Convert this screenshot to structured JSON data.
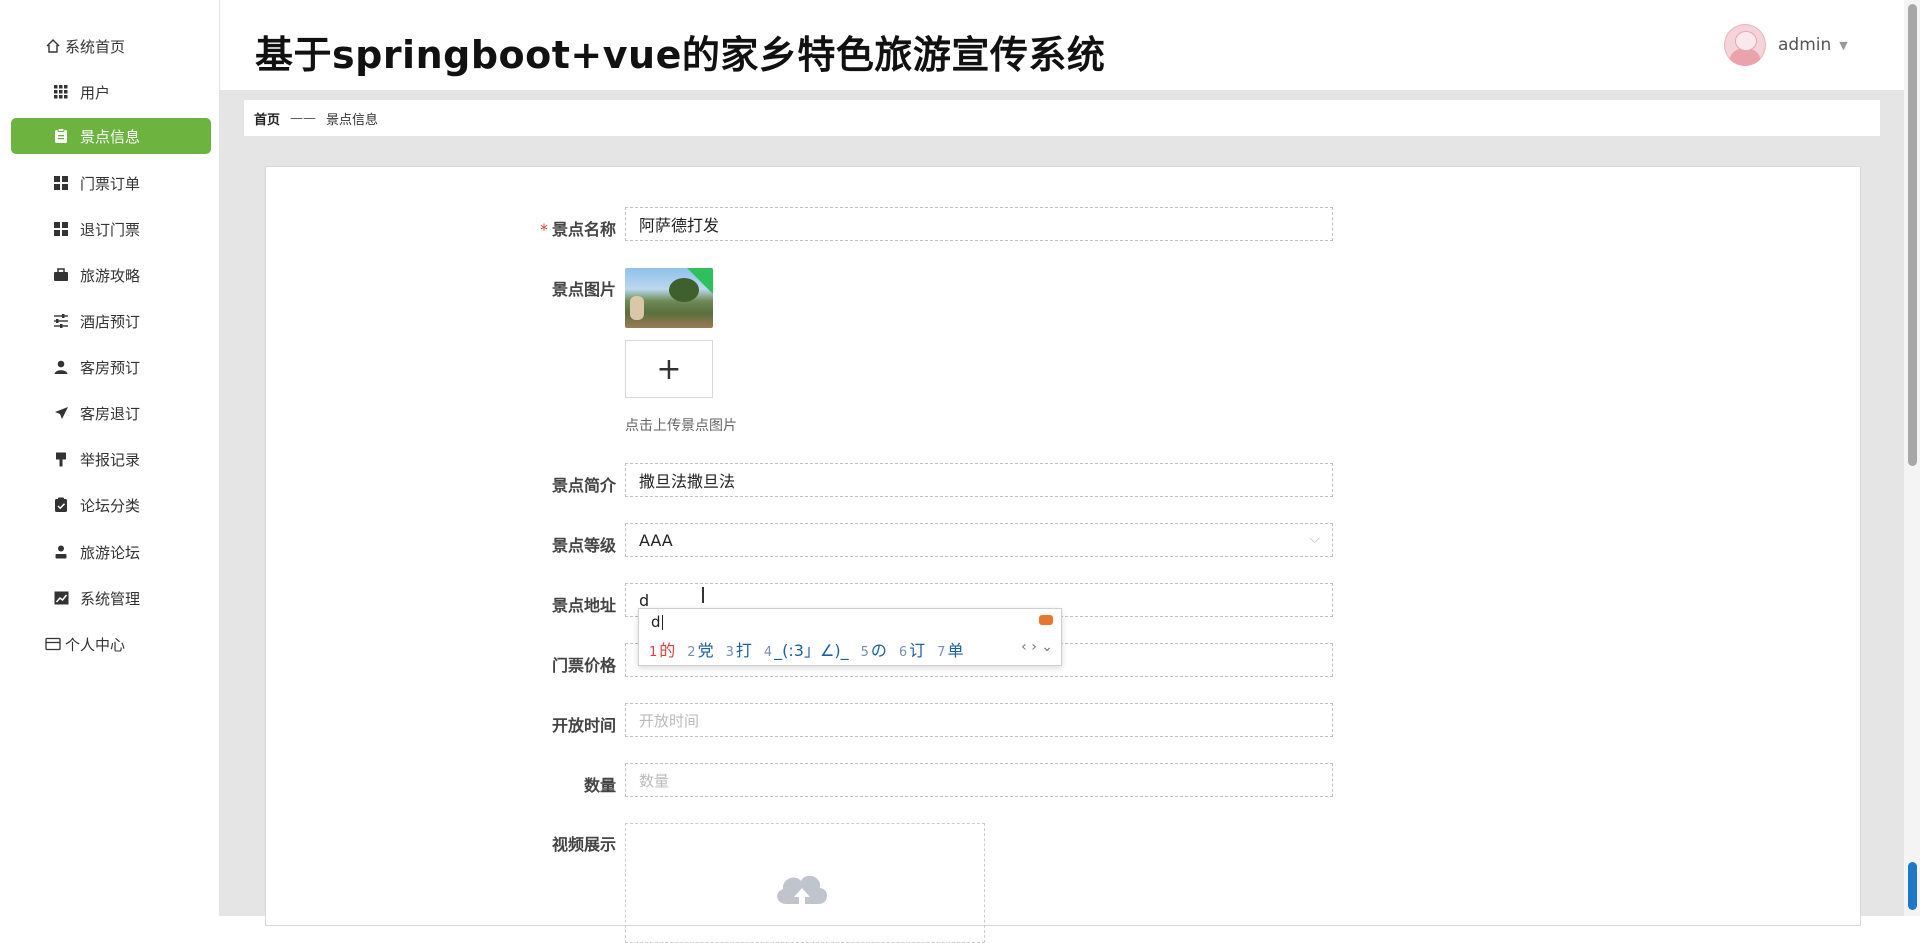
{
  "sidebar": {
    "items": [
      {
        "label": "系统首页",
        "icon": "home-icon",
        "active": false
      },
      {
        "label": "用户",
        "icon": "grid-icon",
        "active": false
      },
      {
        "label": "景点信息",
        "icon": "clipboard-icon",
        "active": true
      },
      {
        "label": "门票订单",
        "icon": "dashboard-icon",
        "active": false
      },
      {
        "label": "退订门票",
        "icon": "dashboard-icon",
        "active": false
      },
      {
        "label": "旅游攻略",
        "icon": "briefcase-icon",
        "active": false
      },
      {
        "label": "酒店预订",
        "icon": "sliders-icon",
        "active": false
      },
      {
        "label": "客房预订",
        "icon": "user-icon",
        "active": false
      },
      {
        "label": "客房退订",
        "icon": "send-icon",
        "active": false
      },
      {
        "label": "举报记录",
        "icon": "pin-icon",
        "active": false
      },
      {
        "label": "论坛分类",
        "icon": "clipboard-check-icon",
        "active": false
      },
      {
        "label": "旅游论坛",
        "icon": "person-icon",
        "active": false
      },
      {
        "label": "系统管理",
        "icon": "chart-icon",
        "active": false
      },
      {
        "label": "个人中心",
        "icon": "card-icon",
        "active": false
      }
    ],
    "active_color": "#6db33f"
  },
  "header": {
    "title": "基于springboot+vue的家乡特色旅游宣传系统",
    "username": "admin"
  },
  "breadcrumb": {
    "home": "首页",
    "separator": "——",
    "current": "景点信息"
  },
  "form": {
    "name_label": "景点名称",
    "name_value": "阿萨德打发",
    "image_label": "景点图片",
    "upload_hint": "点击上传景点图片",
    "intro_label": "景点简介",
    "intro_value": "撒旦法撒旦法",
    "level_label": "景点等级",
    "level_value": "AAA",
    "address_label": "景点地址",
    "address_value": "d",
    "price_label": "门票价格",
    "open_label": "开放时间",
    "open_placeholder": "开放时间",
    "qty_label": "数量",
    "qty_placeholder": "数量",
    "video_label": "视频展示"
  },
  "ime": {
    "input": "d",
    "candidates": [
      {
        "n": "1",
        "text": "的"
      },
      {
        "n": "2",
        "text": "党"
      },
      {
        "n": "3",
        "text": "打"
      },
      {
        "n": "4",
        "text": "_(:3」∠)_"
      },
      {
        "n": "5",
        "text": "の"
      },
      {
        "n": "6",
        "text": "订"
      },
      {
        "n": "7",
        "text": "单"
      }
    ],
    "nav": "‹ › ⌄"
  }
}
